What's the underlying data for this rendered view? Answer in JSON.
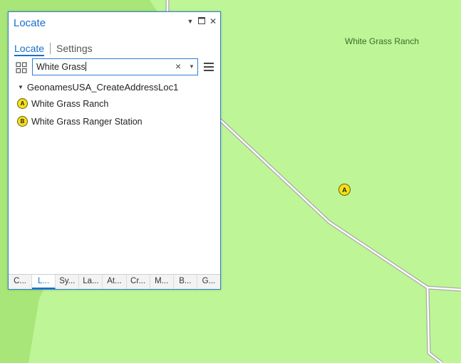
{
  "colors": {
    "map_background": "#a8e67a",
    "map_light_area": "#bef596",
    "road": "#a9a9a9",
    "accent": "#1a6fc9",
    "marker_fill": "#f5e01a"
  },
  "map": {
    "place_label": "White Grass Ranch",
    "marker_letter": "A"
  },
  "pane": {
    "title": "Locate",
    "title_buttons": {
      "pin_icon": "dropdown-triangle",
      "maximize_icon": "maximize-square",
      "close_icon": "close-x"
    },
    "tabs": {
      "locate": "Locate",
      "settings": "Settings"
    },
    "search": {
      "value": "White Grass",
      "clear_icon": "×",
      "dropdown_icon": "▼"
    },
    "locator": {
      "name": "GeonamesUSA_CreateAddressLoc1"
    },
    "results": [
      {
        "badge": "A",
        "label": "White Grass Ranch"
      },
      {
        "badge": "B",
        "label": "White Grass Ranger Station"
      }
    ],
    "bottom_tabs": [
      "C...",
      "L...",
      "Sy...",
      "La...",
      "At...",
      "Cr...",
      "M...",
      "B...",
      "G..."
    ],
    "active_bottom_tab": 1
  }
}
